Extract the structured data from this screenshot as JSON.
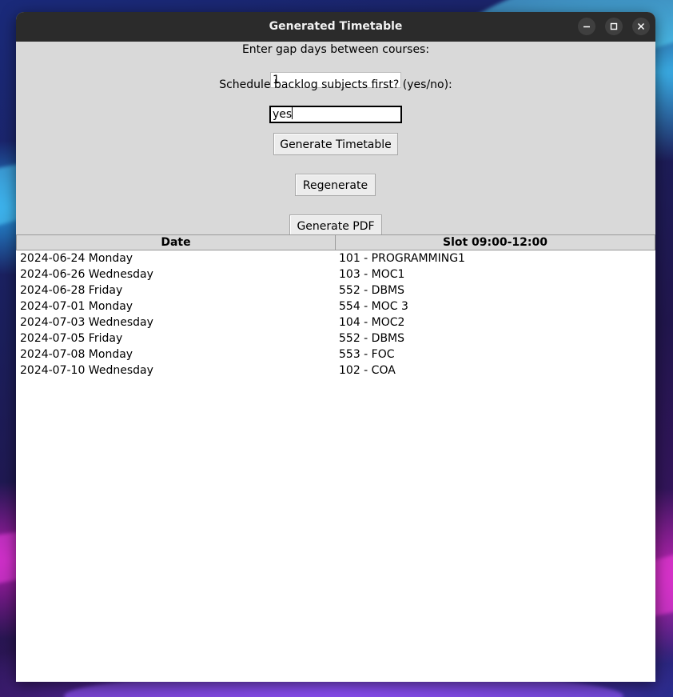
{
  "window": {
    "title": "Generated Timetable"
  },
  "form": {
    "gap_label": "Enter gap days between courses:",
    "gap_value": "1",
    "backlog_label": "Schedule backlog subjects first? (yes/no):",
    "backlog_value": "yes",
    "generate_timetable_label": "Generate Timetable",
    "regenerate_label": "Regenerate",
    "generate_pdf_label": "Generate PDF"
  },
  "table": {
    "columns": [
      "Date",
      "Slot 09:00-12:00"
    ],
    "rows": [
      [
        "2024-06-24 Monday",
        "101 - PROGRAMMING1"
      ],
      [
        "2024-06-26 Wednesday",
        "103 - MOC1"
      ],
      [
        "2024-06-28 Friday",
        "552 - DBMS"
      ],
      [
        "2024-07-01 Monday",
        "554 - MOC 3"
      ],
      [
        "2024-07-03 Wednesday",
        "104 - MOC2"
      ],
      [
        "2024-07-05 Friday",
        "552 - DBMS"
      ],
      [
        "2024-07-08 Monday",
        "553 - FOC"
      ],
      [
        "2024-07-10 Wednesday",
        "102 - COA"
      ]
    ]
  },
  "icons": {
    "minimize": "minimize-icon",
    "maximize": "maximize-icon",
    "close": "close-icon"
  },
  "colors": {
    "titlebar": "#2b2b2b",
    "window_bg": "#d9d9d9",
    "table_bg": "#ffffff"
  }
}
